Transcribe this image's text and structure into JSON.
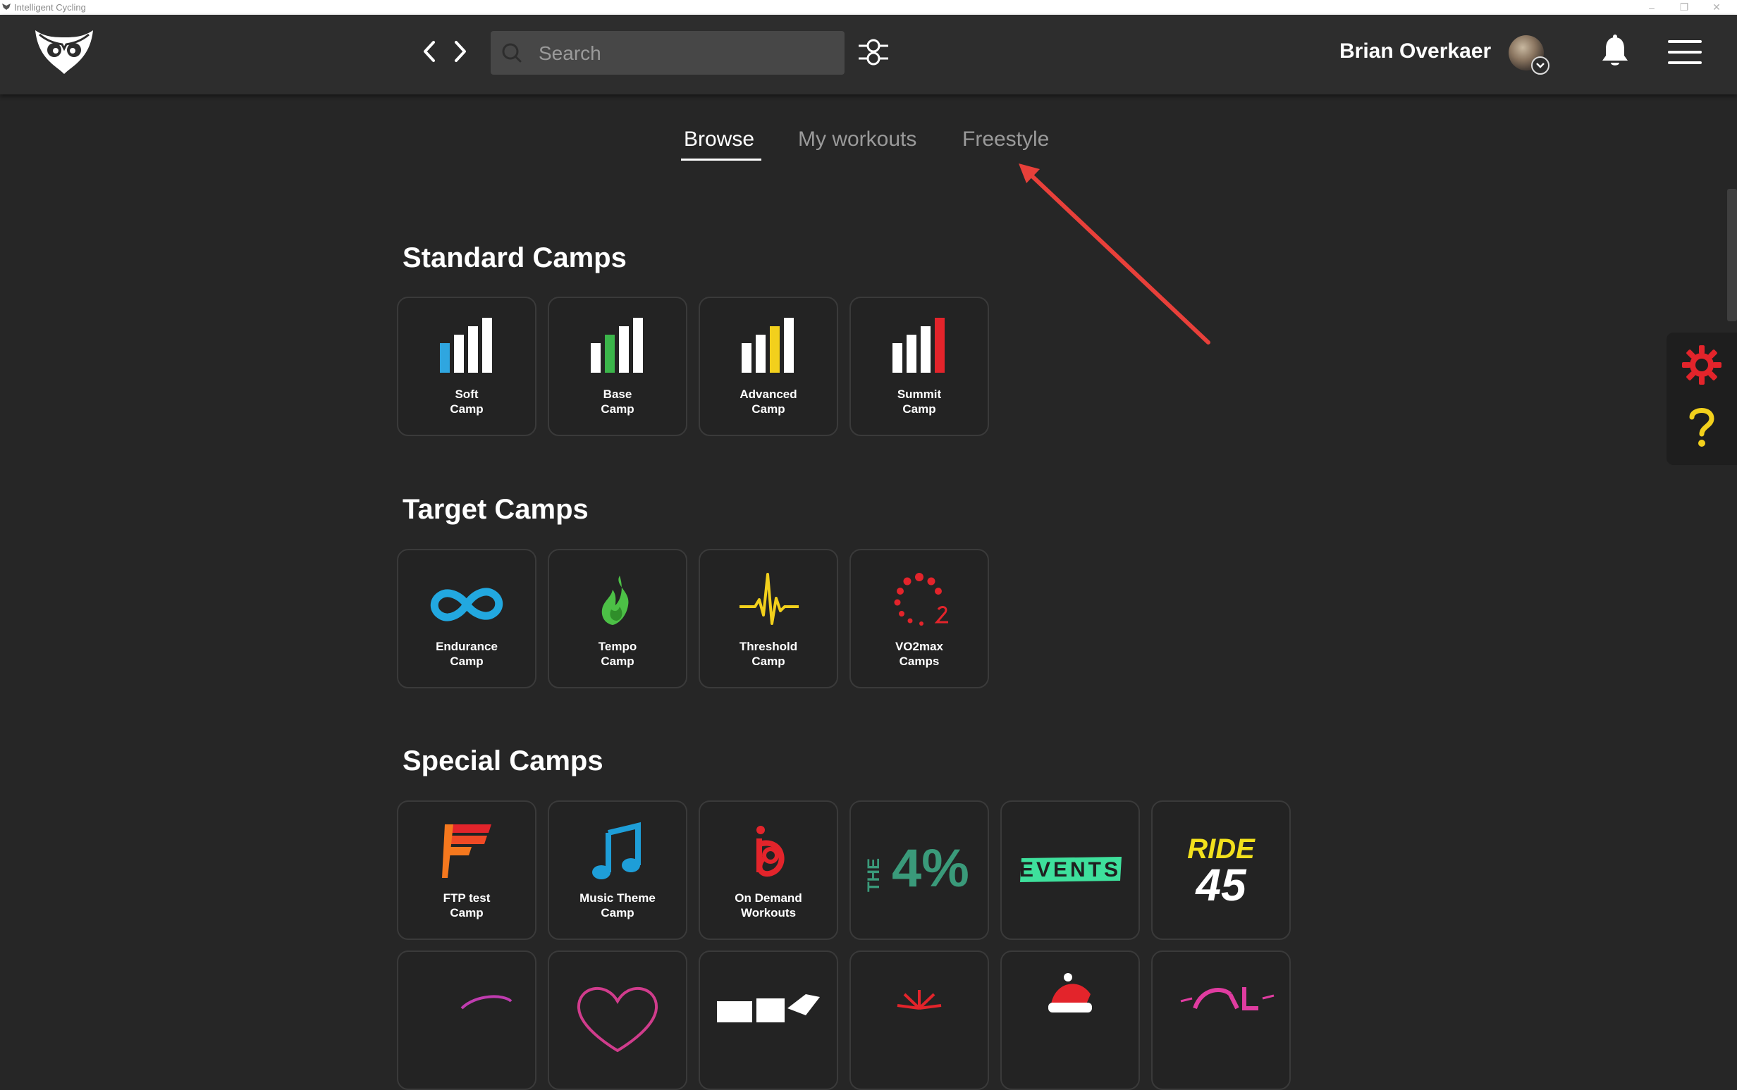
{
  "window": {
    "title": "Intelligent Cycling"
  },
  "header": {
    "search_placeholder": "Search",
    "user_name": "Brian Overkaer"
  },
  "tabs": [
    {
      "label": "Browse",
      "active": true
    },
    {
      "label": "My workouts",
      "active": false
    },
    {
      "label": "Freestyle",
      "active": false
    }
  ],
  "sections": {
    "standard": {
      "title": "Standard Camps",
      "items": [
        {
          "line1": "Soft",
          "line2": "Camp",
          "icon": "signal-bars-blue-icon"
        },
        {
          "line1": "Base",
          "line2": "Camp",
          "icon": "signal-bars-green-icon"
        },
        {
          "line1": "Advanced",
          "line2": "Camp",
          "icon": "signal-bars-yellow-icon"
        },
        {
          "line1": "Summit",
          "line2": "Camp",
          "icon": "signal-bars-red-icon"
        }
      ]
    },
    "target": {
      "title": "Target Camps",
      "items": [
        {
          "line1": "Endurance",
          "line2": "Camp",
          "icon": "infinity-icon"
        },
        {
          "line1": "Tempo",
          "line2": "Camp",
          "icon": "flame-icon"
        },
        {
          "line1": "Threshold",
          "line2": "Camp",
          "icon": "heartbeat-icon"
        },
        {
          "line1": "VO2max",
          "line2": "Camps",
          "icon": "vo2-dots-icon"
        }
      ]
    },
    "special": {
      "title": "Special Camps",
      "items": [
        {
          "line1": "FTP test",
          "line2": "Camp",
          "icon": "ftp-logo-icon"
        },
        {
          "line1": "Music Theme",
          "line2": "Camp",
          "icon": "music-note-icon"
        },
        {
          "line1": "On Demand",
          "line2": "Workouts",
          "icon": "on-demand-icon"
        },
        {
          "text_a": "THE",
          "text_b": "4%",
          "icon": "the-4-percent-logo"
        },
        {
          "text": "EVENTS",
          "icon": "events-logo"
        },
        {
          "text_a": "RIDE",
          "text_b": "45",
          "icon": "ride-45-logo"
        }
      ]
    }
  },
  "colors": {
    "background": "#262626",
    "topbar": "#2d2d2d",
    "settings": "#e3242b",
    "help": "#f2d01c",
    "annotation_arrow": "#e8403a"
  }
}
